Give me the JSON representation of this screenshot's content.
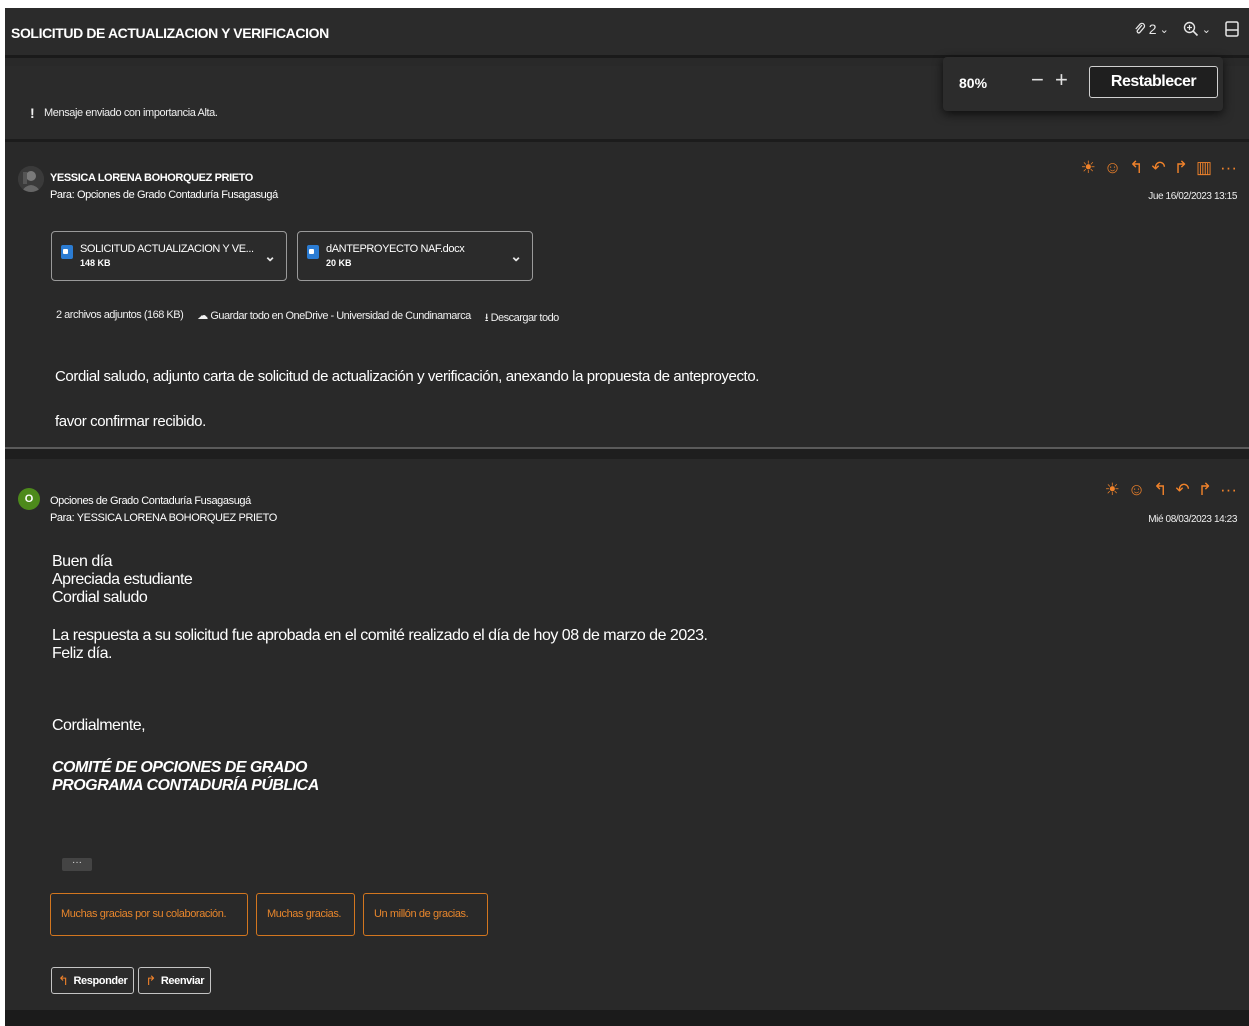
{
  "header": {
    "subject": "SOLICITUD DE ACTUALIZACION Y VERIFICACION",
    "attach_count": "2",
    "icons": [
      "paperclip-icon",
      "zoom-icon",
      "reading-pane-icon"
    ]
  },
  "zoom": {
    "level": "80%",
    "minus": "−",
    "plus": "+",
    "reset_label": "Restablecer"
  },
  "importance": {
    "icon": "!",
    "text": "Mensaje enviado con importancia Alta."
  },
  "message1": {
    "sender": "YESSICA LORENA BOHORQUEZ PRIETO",
    "to": "Para: Opciones de Grado Contaduría Fusagasugá",
    "date": "Jue 16/02/2023 13:15",
    "attachments": [
      {
        "name": "SOLICITUD ACTUALIZACION Y VE...",
        "size": "148 KB"
      },
      {
        "name": "dANTEPROYECTO NAF.docx",
        "size": "20 KB"
      }
    ],
    "attachments_summary": "2 archivos adjuntos (168 KB)",
    "save_onedrive": "Guardar todo en OneDrive - Universidad de Cundinamarca",
    "download_all": "Descargar todo",
    "body": [
      "Cordial saludo, adjunto carta de solicitud de actualización y verificación, anexando la propuesta de anteproyecto.",
      "favor confirmar recibido."
    ]
  },
  "message2": {
    "avatar_letter": "O",
    "sender": "Opciones de Grado Contaduría Fusagasugá",
    "to": "Para: YESSICA LORENA BOHORQUEZ PRIETO",
    "date": "Mié 08/03/2023 14:23",
    "greeting": [
      "Buen día",
      "Apreciada estudiante",
      "Cordial saludo"
    ],
    "response": [
      "La respuesta a su solicitud fue aprobada en el comité realizado el día de hoy 08 de marzo de 2023.",
      "Feliz día."
    ],
    "closing": "Cordialmente,",
    "signature": [
      "COMITÉ DE OPCIONES DE GRADO",
      "PROGRAMA CONTADURÍA PÚBLICA"
    ],
    "more": "···",
    "suggestions": [
      "Muchas gracias por su colaboración.",
      "Muchas gracias.",
      "Un millón de gracias."
    ],
    "reply_label": "Responder",
    "forward_label": "Reenviar"
  },
  "colors": {
    "background": "#292929",
    "accent": "#f0822a",
    "avatar": "#4d8a1b",
    "word_icon": "#2b7cd3"
  }
}
